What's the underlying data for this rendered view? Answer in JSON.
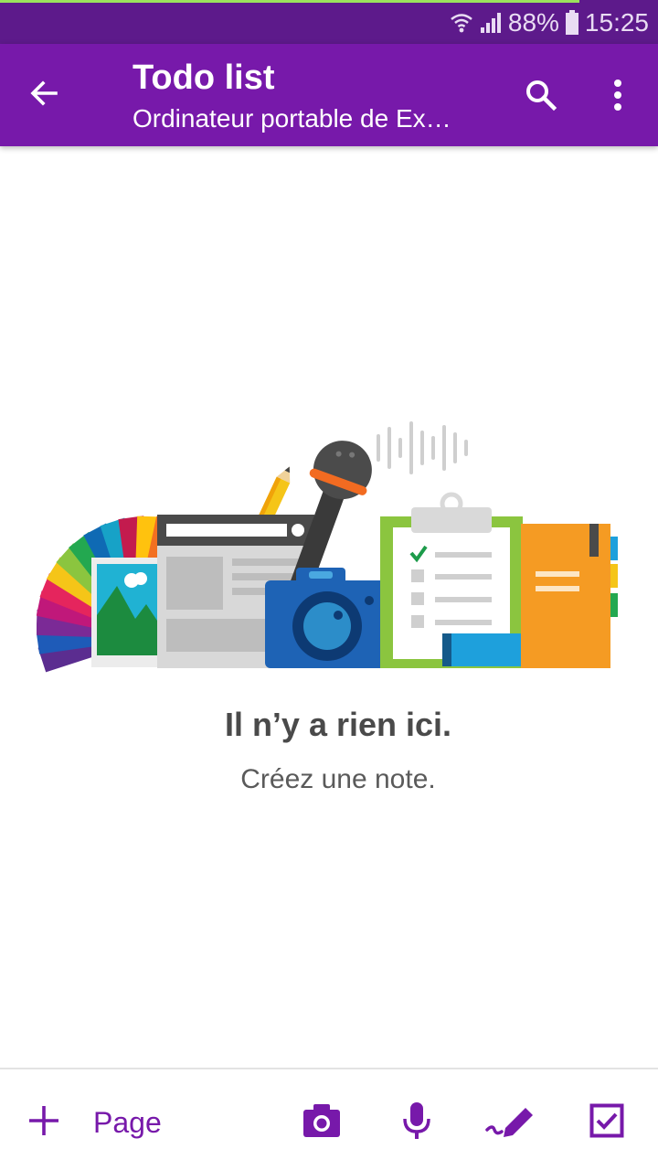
{
  "status_bar": {
    "battery": "88%",
    "time": "15:25",
    "icons": [
      "wifi-icon",
      "signal-icon",
      "battery-icon"
    ]
  },
  "app_bar": {
    "title": "Todo list",
    "subtitle": "Ordinateur portable de Ex…",
    "icons": [
      "back-arrow-icon",
      "search-icon",
      "more-vert-icon"
    ]
  },
  "empty_state": {
    "title": "Il n’y a rien ici.",
    "subtitle": "Créez une note."
  },
  "bottom_bar": {
    "add_page_label": "Page",
    "icons": [
      "plus-icon",
      "camera-icon",
      "microphone-icon",
      "draw-icon",
      "checkbox-icon"
    ]
  },
  "colors": {
    "status_bar": "#5d1a8b",
    "app_bar": "#7719aa",
    "accent": "#7719aa"
  }
}
